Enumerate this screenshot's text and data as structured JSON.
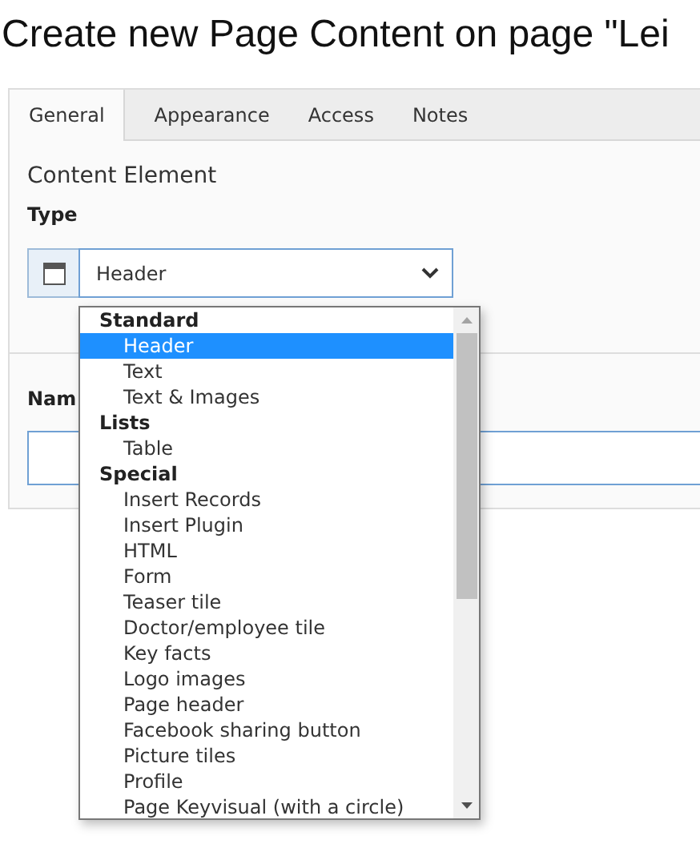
{
  "title": "Create new Page Content on page \"Lei",
  "tabs": [
    {
      "label": "General",
      "selected": true
    },
    {
      "label": "Appearance",
      "selected": false
    },
    {
      "label": "Access",
      "selected": false
    },
    {
      "label": "Notes",
      "selected": false
    }
  ],
  "section_title": "Content Element",
  "type_label": "Type",
  "type_select": {
    "value": "Header"
  },
  "name_label": "Nam",
  "dropdown": [
    {
      "kind": "group",
      "label": "Standard"
    },
    {
      "kind": "option",
      "label": "Header",
      "selected": true
    },
    {
      "kind": "option",
      "label": "Text",
      "selected": false
    },
    {
      "kind": "option",
      "label": "Text & Images",
      "selected": false
    },
    {
      "kind": "group",
      "label": "Lists"
    },
    {
      "kind": "option",
      "label": "Table",
      "selected": false
    },
    {
      "kind": "group",
      "label": "Special"
    },
    {
      "kind": "option",
      "label": "Insert Records",
      "selected": false
    },
    {
      "kind": "option",
      "label": "Insert Plugin",
      "selected": false
    },
    {
      "kind": "option",
      "label": "HTML",
      "selected": false
    },
    {
      "kind": "option",
      "label": "Form",
      "selected": false
    },
    {
      "kind": "option",
      "label": "Teaser tile",
      "selected": false
    },
    {
      "kind": "option",
      "label": "Doctor/employee tile",
      "selected": false
    },
    {
      "kind": "option",
      "label": "Key facts",
      "selected": false
    },
    {
      "kind": "option",
      "label": "Logo images",
      "selected": false
    },
    {
      "kind": "option",
      "label": "Page header",
      "selected": false
    },
    {
      "kind": "option",
      "label": "Facebook sharing button",
      "selected": false
    },
    {
      "kind": "option",
      "label": "Picture tiles",
      "selected": false
    },
    {
      "kind": "option",
      "label": "Profile",
      "selected": false
    },
    {
      "kind": "option",
      "label": "Page Keyvisual (with a circle)",
      "selected": false
    }
  ]
}
